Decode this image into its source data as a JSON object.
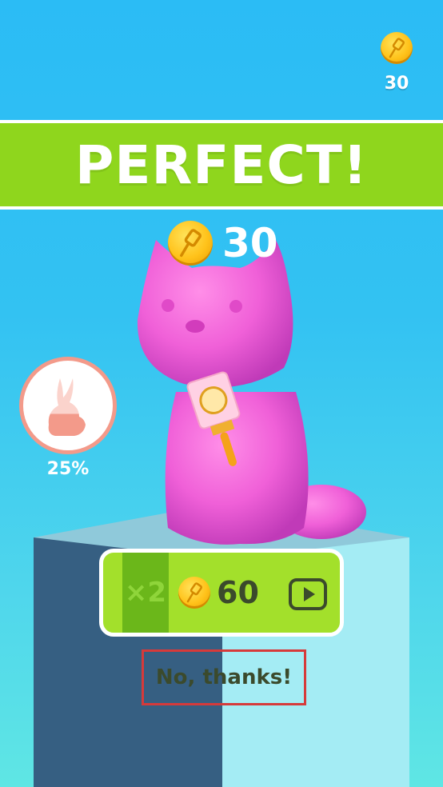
{
  "top_hud": {
    "coin_icon": "coin-brush-icon",
    "coin_count": "30"
  },
  "banner": {
    "text": "PERFECT!"
  },
  "reward": {
    "coin_icon": "coin-brush-icon",
    "amount": "30"
  },
  "next_unlock": {
    "icon": "rabbit-silhouette-icon",
    "percent": "25%"
  },
  "multiplier_button": {
    "multiplier": "×2",
    "coin_icon": "coin-brush-icon",
    "amount": "60",
    "action_icon": "play-video-icon"
  },
  "skip_button": {
    "label": "No, thanks!"
  },
  "colors": {
    "sky": "#33c2f2",
    "banner": "#8fd61d",
    "cat": "#f060d8",
    "button_green": "#a3e02b",
    "highlight_box": "#d63a3a"
  }
}
